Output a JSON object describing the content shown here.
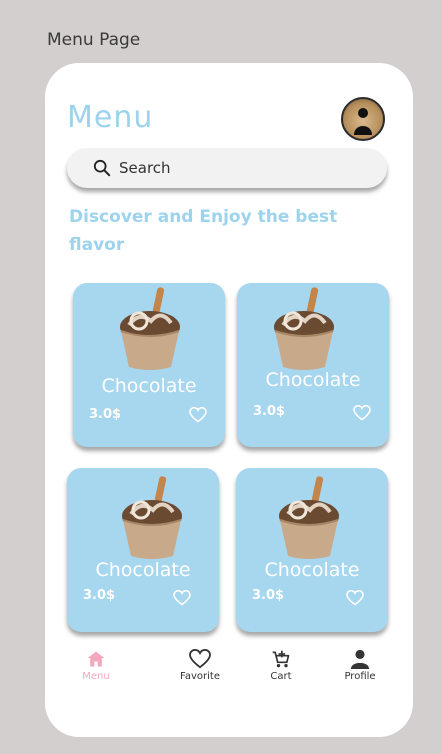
{
  "caption": "Menu Page",
  "header": {
    "title": "Menu"
  },
  "search": {
    "placeholder": "Search"
  },
  "headline": "Discover and Enjoy the best flavor",
  "products": [
    {
      "name": "Chocolate",
      "price": "3.0$"
    },
    {
      "name": "Chocolate",
      "price": "3.0$"
    },
    {
      "name": "Chocolate",
      "price": "3.0$"
    },
    {
      "name": "Chocolate",
      "price": "3.0$"
    }
  ],
  "nav": {
    "items": [
      {
        "label": "Menu",
        "icon": "home-icon",
        "active": true
      },
      {
        "label": "Favorite",
        "icon": "heart-icon",
        "active": false
      },
      {
        "label": "Cart",
        "icon": "cart-icon",
        "active": false
      },
      {
        "label": "Profile",
        "icon": "user-icon",
        "active": false
      }
    ]
  },
  "colors": {
    "background": "#d3cfce",
    "accent": "#9dd3ed",
    "card": "#a7d6ef",
    "active_nav": "#f3a8bd"
  }
}
